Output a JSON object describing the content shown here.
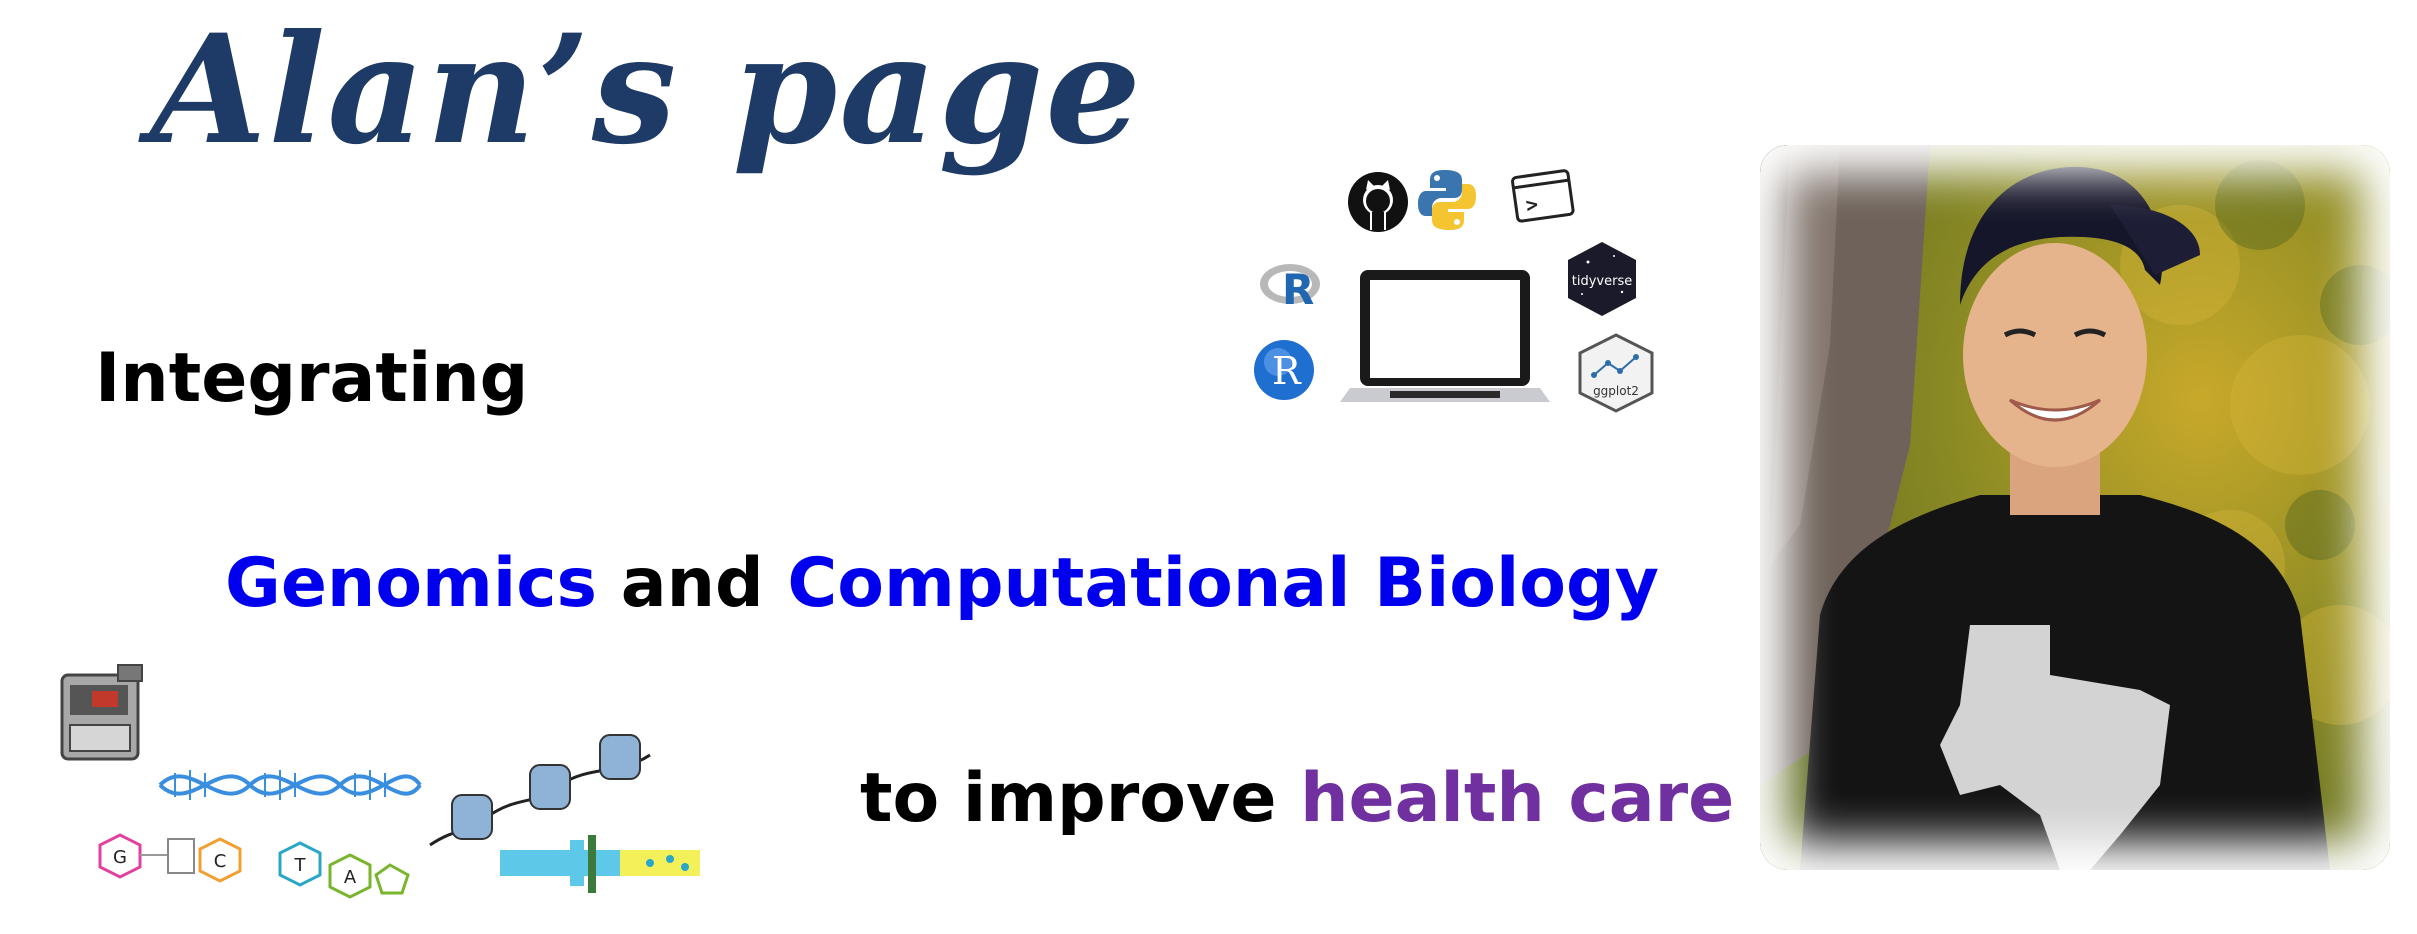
{
  "header": {
    "title": "Alan’s page"
  },
  "tagline": {
    "line1": "Integrating",
    "line2_part1": "Genomics",
    "line2_part2": " and ",
    "line2_part3": "Computational Biology",
    "line3_part1": "to improve ",
    "line3_part2": "health care"
  },
  "tech_icons": {
    "tidyverse_label": "tidyverse",
    "ggplot2_label": "ggplot2",
    "rstudio_label": "R",
    "r_label": "R",
    "terminal_label": ">"
  },
  "bio_icons": {
    "base_g": "G",
    "base_c": "C",
    "base_t": "T",
    "base_a": "A"
  },
  "colors": {
    "title": "#1e3a66",
    "highlight_blue": "#0000ee",
    "highlight_purple": "#7030a0"
  }
}
